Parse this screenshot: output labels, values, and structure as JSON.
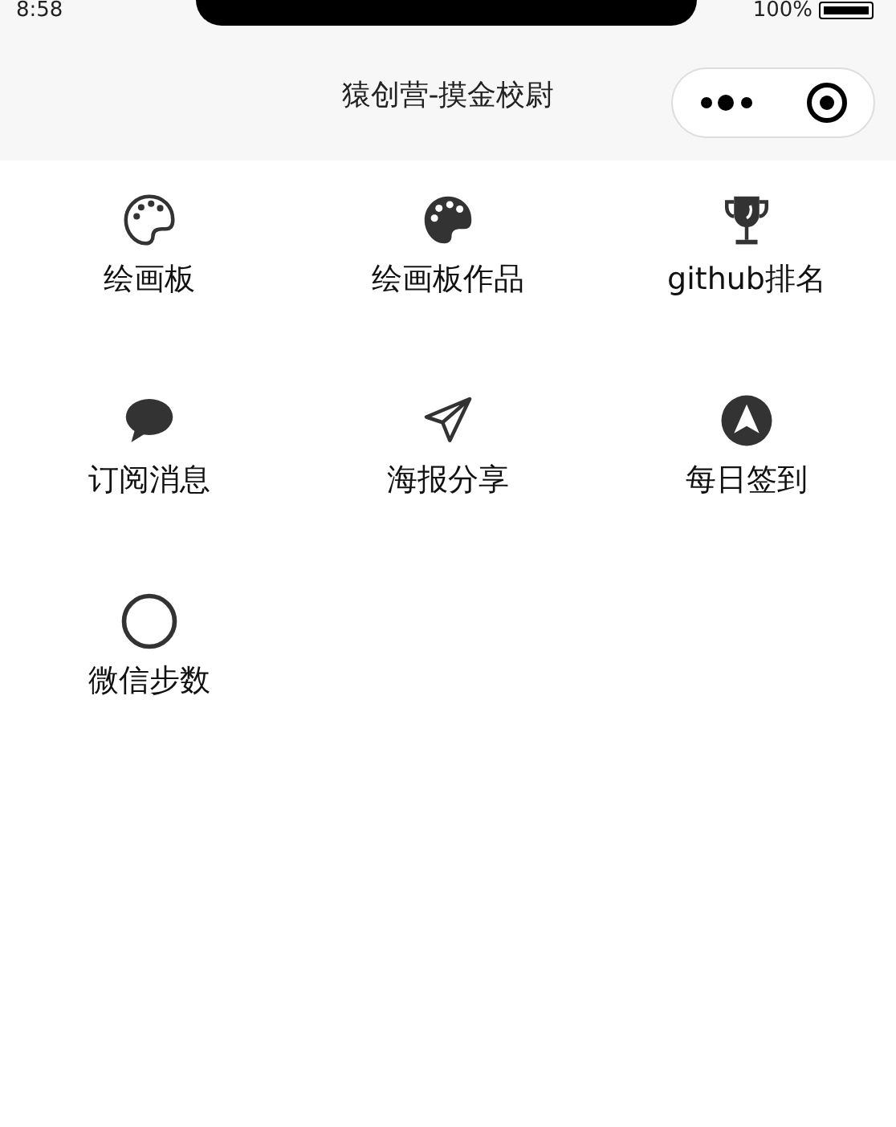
{
  "status_bar": {
    "time": "8:58",
    "battery": "100%"
  },
  "nav_bar": {
    "title": "猿创营-摸金校尉"
  },
  "menu": [
    {
      "kind": "palette-outline",
      "label": "绘画板"
    },
    {
      "kind": "palette",
      "label": "绘画板作品"
    },
    {
      "kind": "trophy",
      "label": "github排名"
    },
    {
      "kind": "chat",
      "label": "订阅消息"
    },
    {
      "kind": "send",
      "label": "海报分享"
    },
    {
      "kind": "navigate",
      "label": "每日签到"
    },
    {
      "kind": "circle",
      "label": "微信步数"
    }
  ]
}
